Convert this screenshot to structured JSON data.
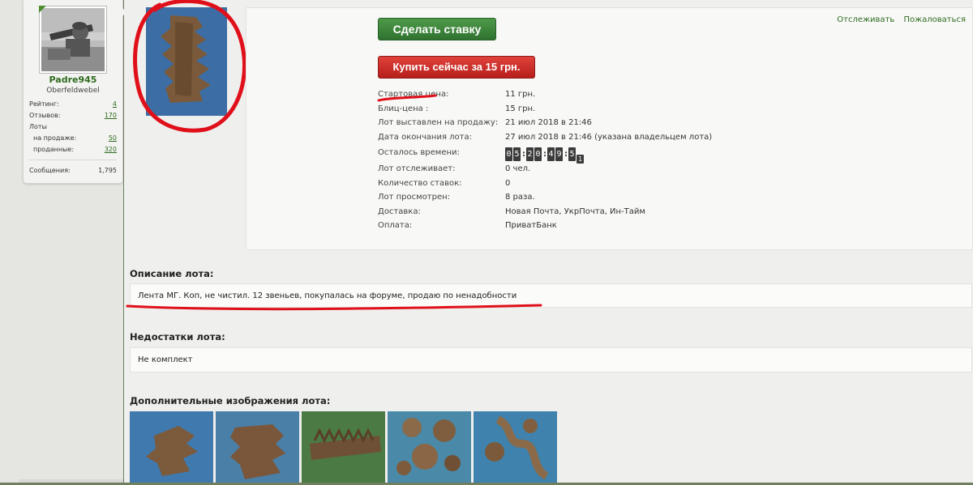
{
  "user": {
    "name": "Padre945",
    "rank": "Oberfeldwebel",
    "stats": [
      {
        "label": "Рейтинг:",
        "value": "4",
        "link": true,
        "indent": false
      },
      {
        "label": "Отзывов:",
        "value": "170",
        "link": true,
        "indent": false
      },
      {
        "label": "Лоты",
        "value": "",
        "link": false,
        "indent": false
      },
      {
        "label": "на продаже:",
        "value": "50",
        "link": true,
        "indent": true
      },
      {
        "label": "проданные:",
        "value": "320",
        "link": true,
        "indent": true
      },
      {
        "label": "Сообщения:",
        "value": "1,795",
        "link": false,
        "indent": false
      }
    ]
  },
  "actions": {
    "bid": "Сделать ставку",
    "buy_now": "Купить сейчас за 15 грн.",
    "watch": "Отслеживать",
    "report": "Пожаловаться"
  },
  "details": {
    "start_price": {
      "label": "Стартовая цена:",
      "value": "11 грн."
    },
    "blitz_price": {
      "label": "Блиц-цена :",
      "value": "15 грн."
    },
    "listed": {
      "label": "Лот выставлен на продажу:",
      "value": "21 июл 2018 в 21:46"
    },
    "ends": {
      "label": "Дата окончания лота:",
      "value": "27 июл 2018 в 21:46 (указана владельцем лота)"
    },
    "time_left": {
      "label": "Осталось времени:",
      "digits": [
        "0",
        "5",
        "2",
        "0",
        "4",
        "9",
        "5"
      ],
      "small_digit": "1"
    },
    "watching": {
      "label": "Лот отслеживает:",
      "value": "0 чел."
    },
    "bids": {
      "label": "Количество ставок:",
      "value": "0"
    },
    "views": {
      "label": "Лот просмотрен:",
      "value": "8 раза."
    },
    "delivery": {
      "label": "Доставка:",
      "value": "Новая Почта, УкрПочта, Ин-Тайм"
    },
    "payment": {
      "label": "Оплата:",
      "value": "ПриватБанк"
    }
  },
  "description": {
    "title": "Описание лота:",
    "text": "Лента МГ. Коп, не чистил. 12 звеньев, покупалась на форуме, продаю по ненадобности"
  },
  "flaws": {
    "title": "Недостатки лота:",
    "text": "Не комплект"
  },
  "extra_images": {
    "title": "Дополнительные изображения лота:",
    "count": 5
  },
  "colors": {
    "green_button": "#3f8a3b",
    "red_button": "#c82a26",
    "link_green": "#2f6b1f",
    "annotation_red": "#e0101a"
  }
}
